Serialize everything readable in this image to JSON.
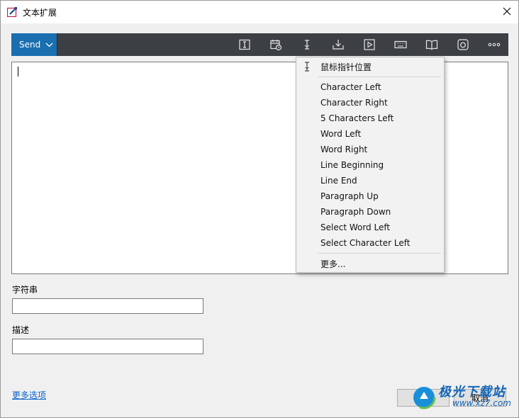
{
  "window": {
    "title": "文本扩展"
  },
  "toolbar": {
    "send_label": "Send",
    "icons": [
      "text-cursor-box-icon",
      "calendar-clock-icon",
      "cursor-position-icon",
      "download-tray-icon",
      "play-box-icon",
      "keyboard-icon",
      "book-icon",
      "snapshot-icon",
      "more-horizontal-icon"
    ]
  },
  "editor": {
    "content": ""
  },
  "fields": {
    "string_label": "字符串",
    "string_value": "",
    "description_label": "描述",
    "description_value": ""
  },
  "footer": {
    "more_options": "更多选项",
    "ok_label": "确定",
    "cancel_label": "取消"
  },
  "watermark": {
    "title": "极光下载站",
    "url": "www.xz7.com"
  },
  "dropdown": {
    "header": "鼠标指针位置",
    "items": [
      "Character Left",
      "Character Right",
      "5 Characters Left",
      "Word Left",
      "Word Right",
      "Line Beginning",
      "Line End",
      "Paragraph Up",
      "Paragraph Down",
      "Select Word Left",
      "Select Character Left"
    ],
    "more": "更多..."
  },
  "colors": {
    "toolbar_bg": "#3c3f43",
    "accent": "#1a6fb0",
    "link": "#0a63c9"
  }
}
